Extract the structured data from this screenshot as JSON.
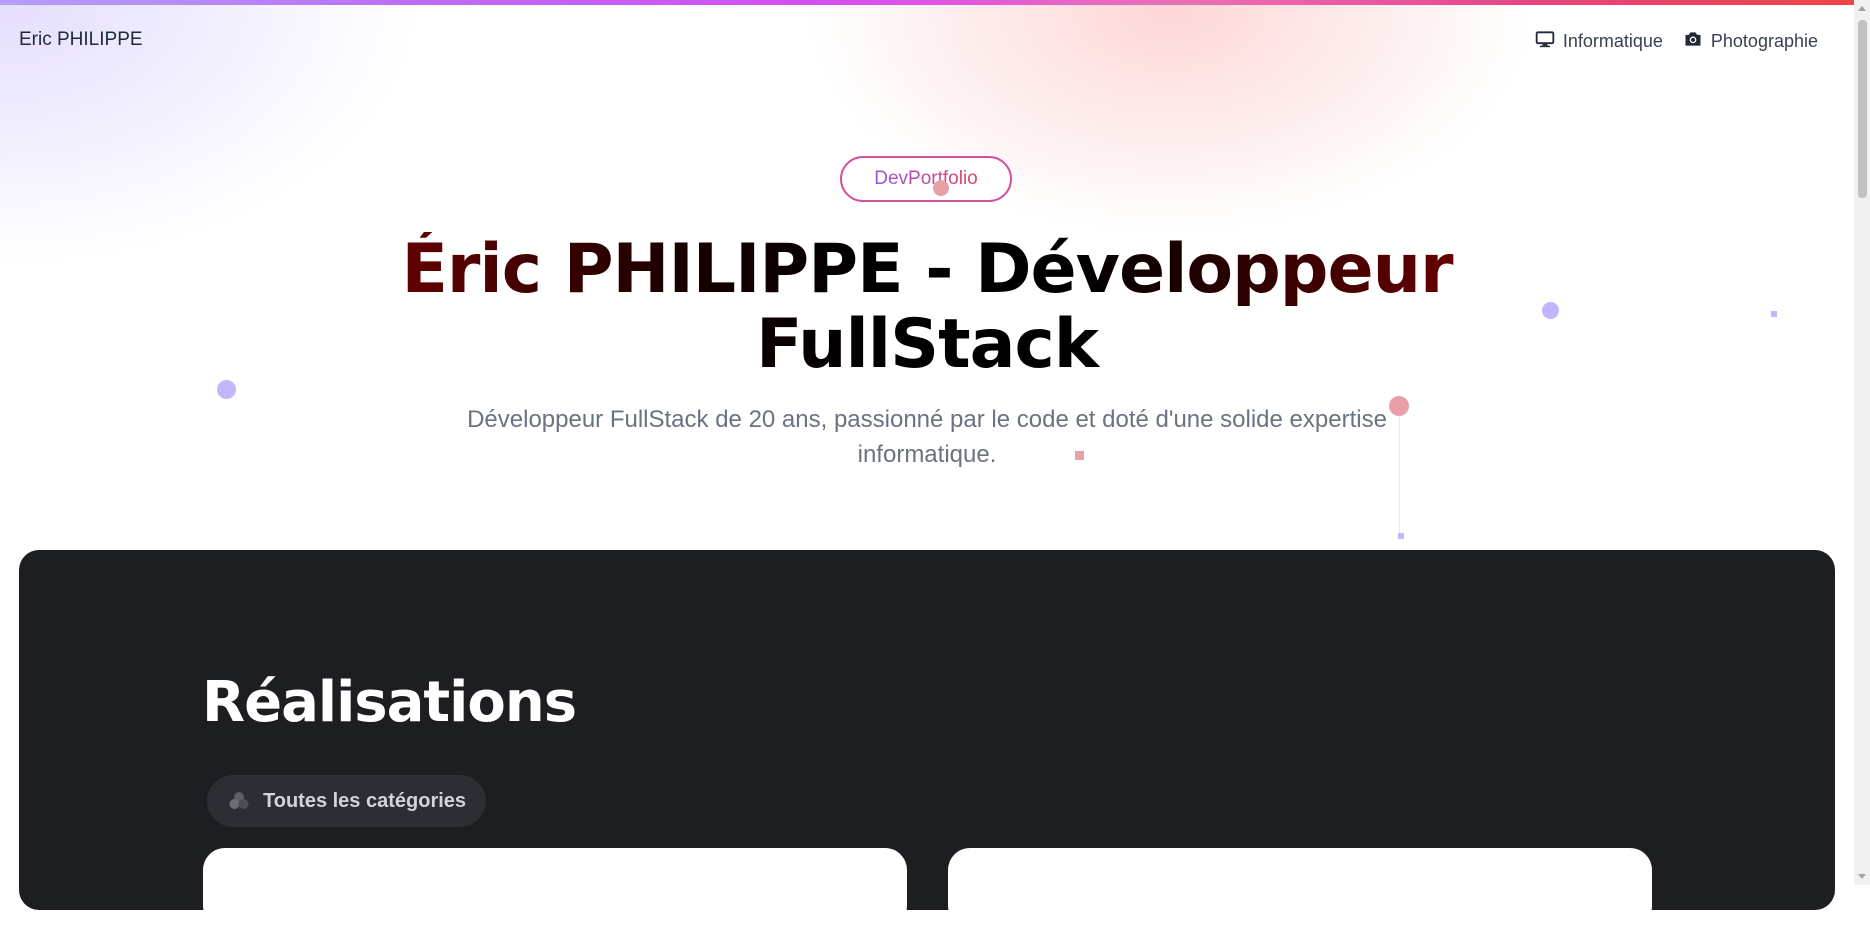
{
  "navbar": {
    "brand": "Eric PHILIPPE",
    "links": [
      {
        "label": "Informatique",
        "icon": "monitor-icon"
      },
      {
        "label": "Photographie",
        "icon": "camera-icon"
      }
    ]
  },
  "hero": {
    "badge": "DevPortfolio",
    "title_line1": "Éric PHILIPPE - Développeur",
    "title_line2": "FullStack",
    "subtitle": "Développeur FullStack de 20 ans, passionné par le code et doté d'une solide expertise informatique."
  },
  "projects": {
    "title": "Réalisations",
    "filter_label": "Toutes les catégories",
    "filter_icon": "categories-icon"
  },
  "colors": {
    "accent_purple": "#a78bfa",
    "accent_red": "#ef4444",
    "dark_panel": "#1c1e22"
  }
}
